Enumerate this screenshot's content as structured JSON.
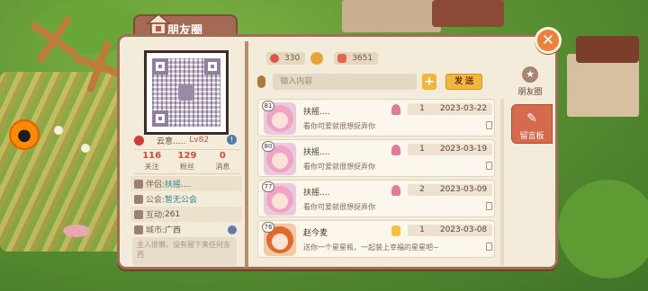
{
  "panel": {
    "title": "朋友圈"
  },
  "profile": {
    "name": "云意.....",
    "level": "Lv82",
    "stats": [
      {
        "value": "116",
        "label": "关注"
      },
      {
        "value": "129",
        "label": "粉丝"
      },
      {
        "value": "0",
        "label": "消息"
      }
    ],
    "info": [
      {
        "label": "伴侣:",
        "value": "扶摇...."
      },
      {
        "label": "公会:",
        "value": "暂无公会"
      },
      {
        "label": "互动:",
        "value": "261"
      },
      {
        "label": "城市:",
        "value": "广西"
      }
    ],
    "bio": "主人很懒，没有留下来任何东西"
  },
  "top_stats": {
    "roses": "330",
    "likes": "3651"
  },
  "composer": {
    "placeholder": "输入内容",
    "plus": "+",
    "send_label": "发 送"
  },
  "messages": [
    {
      "level": "81",
      "name": "扶摇....",
      "text": "看你可爱就很想捉弄你",
      "gift_type": "lollipop",
      "count": "1",
      "date": "2023-03-22"
    },
    {
      "level": "80",
      "name": "扶摇....",
      "text": "看你可爱就很想捉弄你",
      "gift_type": "lollipop",
      "count": "1",
      "date": "2023-03-19"
    },
    {
      "level": "77",
      "name": "扶摇....",
      "text": "看你可爱就很想捉弄你",
      "gift_type": "lollipop",
      "count": "2",
      "date": "2023-03-09"
    },
    {
      "level": "76",
      "name": "赵今麦",
      "text": "送你一个星星瓶，一起装上幸福的星星吧~",
      "gift_type": "star-bottle",
      "count": "1",
      "date": "2023-03-08"
    }
  ],
  "side_tabs": [
    {
      "label": "朋友圈",
      "icon": "star-icon",
      "active": false
    },
    {
      "label": "留言板",
      "icon": "edit-icon",
      "active": true
    }
  ],
  "close_glyph": "✕",
  "colors": {
    "panel_bg": "#f4ecdb",
    "panel_border": "#a26d55",
    "accent_red": "#d24a3a",
    "accent_gold": "#f3b53a",
    "active_tab": "#d66a4c"
  }
}
